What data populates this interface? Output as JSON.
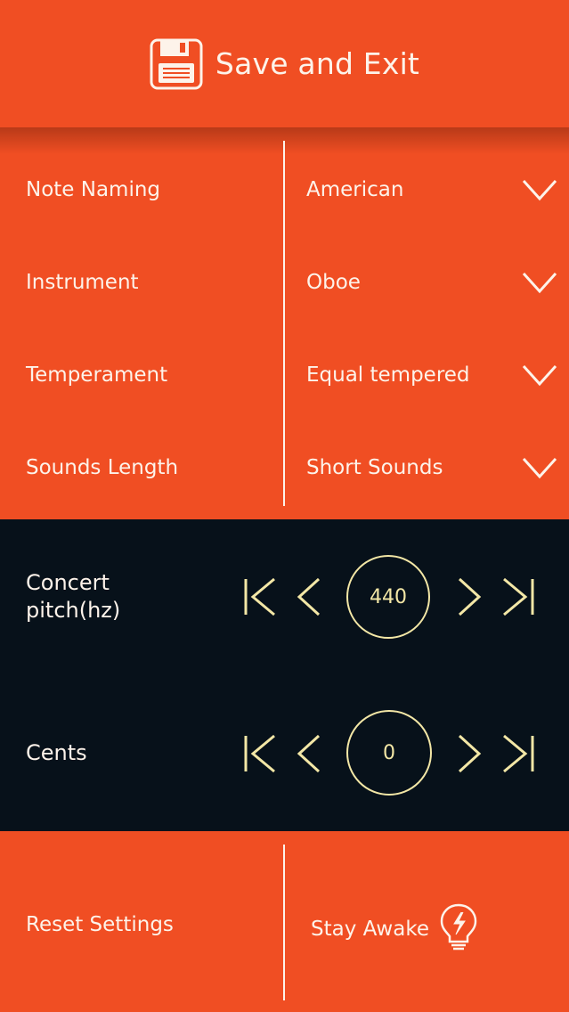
{
  "header": {
    "save_label": "Save and Exit",
    "icon": "floppy-disk-icon"
  },
  "settings": [
    {
      "label": "Note Naming",
      "value": "American"
    },
    {
      "label": "Instrument",
      "value": "Oboe"
    },
    {
      "label": "Temperament",
      "value": "Equal tempered"
    },
    {
      "label": "Sounds Length",
      "value": "Short Sounds"
    }
  ],
  "concert_pitch": {
    "label": "Concert pitch(hz)",
    "value": "440"
  },
  "cents": {
    "label": "Cents",
    "value": "0"
  },
  "bottom": {
    "reset_label": "Reset Settings",
    "awake_label": "Stay Awake",
    "awake_icon": "lightbulb-bolt-icon"
  },
  "colors": {
    "accent": "#f04e23",
    "dark": "#07111a",
    "stroke": "#f3e7a6",
    "text": "#fdf3ea"
  }
}
